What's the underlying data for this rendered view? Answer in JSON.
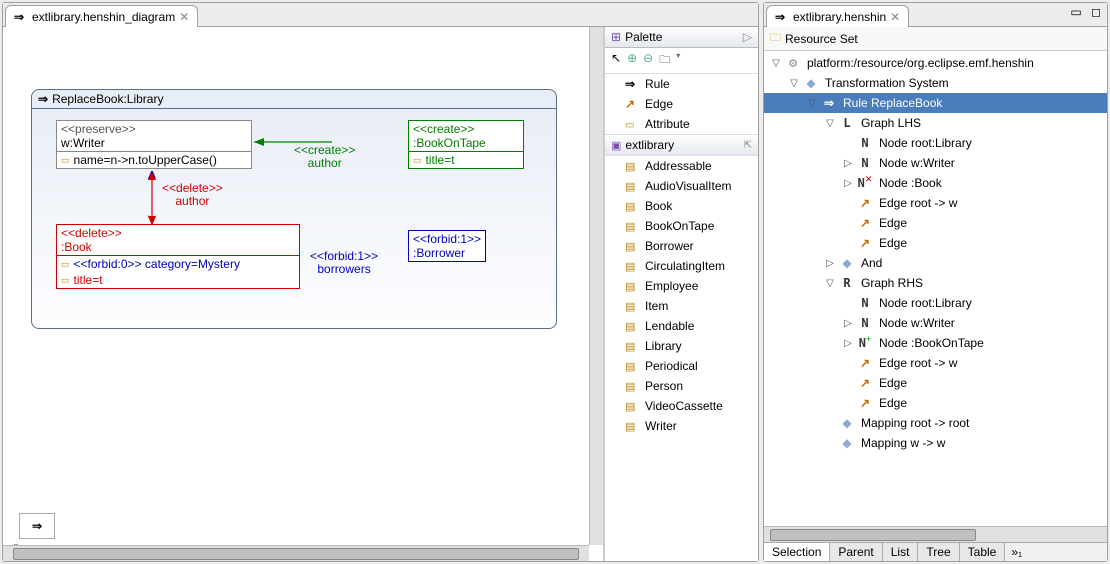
{
  "left_tab": {
    "title": "extlibrary.henshin_diagram"
  },
  "right_tab": {
    "title": "extlibrary.henshin"
  },
  "resource_set_label": "Resource Set",
  "rule": {
    "title": "ReplaceBook:Library",
    "nodes": {
      "preserve": {
        "stereo": "<<preserve>>",
        "name": "w:Writer",
        "attr": "name=n->n.toUpperCase()"
      },
      "create": {
        "stereo": "<<create>>",
        "name": ":BookOnTape",
        "attr": "title=t"
      },
      "delete": {
        "stereo": "<<delete>>",
        "name": ":Book",
        "attr1": "<<forbid:0>> category=Mystery",
        "attr2": "title=t"
      },
      "forbid": {
        "stereo": "<<forbid:1>>",
        "name": ":Borrower"
      }
    },
    "edges": {
      "del_author": {
        "stereo": "<<delete>>",
        "role": "author"
      },
      "create_author": {
        "stereo": "<<create>>",
        "role": "author"
      },
      "forbid_borrowers": {
        "stereo": "<<forbid:1>>",
        "role": "borrowers"
      }
    }
  },
  "palette": {
    "title": "Palette",
    "tools": [
      {
        "label": "Rule",
        "icon": "arrow"
      },
      {
        "label": "Edge",
        "icon": "edge"
      },
      {
        "label": "Attribute",
        "icon": "attr"
      }
    ],
    "section": "extlibrary",
    "classes": [
      "Addressable",
      "AudioVisualItem",
      "Book",
      "BookOnTape",
      "Borrower",
      "CirculatingItem",
      "Employee",
      "Item",
      "Lendable",
      "Library",
      "Periodical",
      "Person",
      "VideoCassette",
      "Writer"
    ]
  },
  "tree": [
    {
      "depth": 0,
      "tw": "▽",
      "icon": "gear",
      "label": "platform:/resource/org.eclipse.emf.henshin"
    },
    {
      "depth": 1,
      "tw": "▽",
      "icon": "diamond",
      "label": "Transformation System"
    },
    {
      "depth": 2,
      "tw": "▽",
      "icon": "arrow",
      "label": "Rule ReplaceBook",
      "selected": true
    },
    {
      "depth": 3,
      "tw": "▽",
      "icon": "L",
      "label": "Graph LHS"
    },
    {
      "depth": 4,
      "tw": "",
      "icon": "N",
      "label": "Node root:Library"
    },
    {
      "depth": 4,
      "tw": "▷",
      "icon": "N",
      "label": "Node w:Writer"
    },
    {
      "depth": 4,
      "tw": "▷",
      "icon": "Nx",
      "label": "Node :Book"
    },
    {
      "depth": 4,
      "tw": "",
      "icon": "edge",
      "label": "Edge root -> w"
    },
    {
      "depth": 4,
      "tw": "",
      "icon": "edge",
      "label": "Edge"
    },
    {
      "depth": 4,
      "tw": "",
      "icon": "edge",
      "label": "Edge"
    },
    {
      "depth": 3,
      "tw": "▷",
      "icon": "diamond",
      "label": "And"
    },
    {
      "depth": 3,
      "tw": "▽",
      "icon": "R",
      "label": "Graph RHS"
    },
    {
      "depth": 4,
      "tw": "",
      "icon": "N",
      "label": "Node root:Library"
    },
    {
      "depth": 4,
      "tw": "▷",
      "icon": "N",
      "label": "Node w:Writer"
    },
    {
      "depth": 4,
      "tw": "▷",
      "icon": "N+",
      "label": "Node :BookOnTape"
    },
    {
      "depth": 4,
      "tw": "",
      "icon": "edge",
      "label": "Edge root -> w"
    },
    {
      "depth": 4,
      "tw": "",
      "icon": "edge",
      "label": "Edge"
    },
    {
      "depth": 4,
      "tw": "",
      "icon": "edge",
      "label": "Edge"
    },
    {
      "depth": 3,
      "tw": "",
      "icon": "diamond",
      "label": "Mapping root -> root"
    },
    {
      "depth": 3,
      "tw": "",
      "icon": "diamond",
      "label": "Mapping w -> w"
    }
  ],
  "bottom_tabs": [
    "Selection",
    "Parent",
    "List",
    "Tree",
    "Table"
  ],
  "bottom_more": "»₁"
}
